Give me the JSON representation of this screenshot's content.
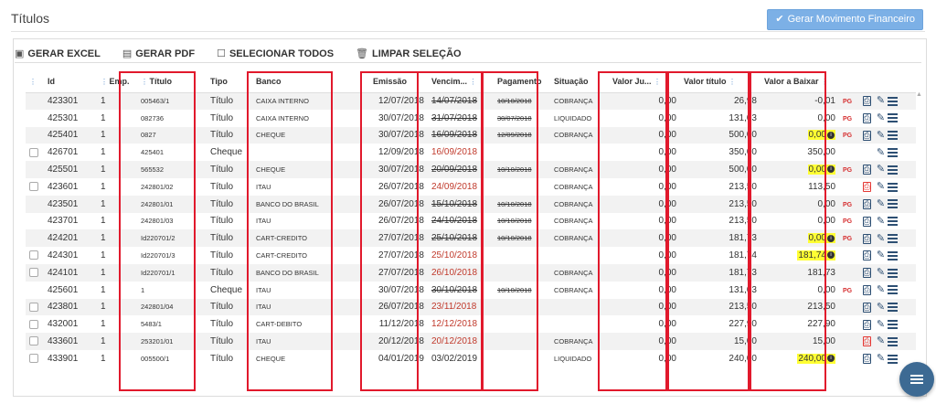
{
  "page": {
    "title": "Títulos",
    "primary_button": "Gerar Movimento Financeiro"
  },
  "toolbar": {
    "export_excel": "GERAR EXCEL",
    "export_pdf": "GERAR PDF",
    "select_all": "SELECIONAR TODOS",
    "clear_selection": "LIMPAR SELEÇÃO"
  },
  "table": {
    "headers": {
      "id": "Id",
      "emp": "Emp.",
      "titulo": "Título",
      "tipo": "Tipo",
      "banco": "Banco",
      "emissao": "Emissão",
      "vencimento": "Vencim...",
      "pagamento": "Pagamento",
      "situacao": "Situação",
      "valor_juros": "Valor Ju...",
      "valor_titulo": "Valor título",
      "valor_baixar": "Valor a Baixar"
    },
    "pg_label": "PG",
    "rows": [
      {
        "checkbox": false,
        "id": "423301",
        "emp": "1",
        "titulo": "005463/1",
        "tipo": "Título",
        "banco": "CAIXA INTERNO",
        "emissao": "12/07/2018",
        "vencimento": "14/07/2018",
        "venc_style": "strike",
        "pagamento": "10/10/2018",
        "situacao": "COBRANÇA",
        "valor_juros": "0,00",
        "valor_titulo": "26,98",
        "valor_baixar": "-0,01",
        "baixar_hl": false,
        "pg": true,
        "pdf_red": false
      },
      {
        "checkbox": false,
        "id": "425301",
        "emp": "1",
        "titulo": "082736",
        "tipo": "Título",
        "banco": "CAIXA INTERNO",
        "emissao": "30/07/2018",
        "vencimento": "31/07/2018",
        "venc_style": "strike",
        "pagamento": "30/07/2018",
        "situacao": "LIQUIDADO",
        "valor_juros": "0,00",
        "valor_titulo": "131,03",
        "valor_baixar": "0,00",
        "baixar_hl": false,
        "pg": true,
        "pdf_red": false
      },
      {
        "checkbox": false,
        "id": "425401",
        "emp": "1",
        "titulo": "0827",
        "tipo": "Título",
        "banco": "CHEQUE",
        "emissao": "30/07/2018",
        "vencimento": "16/09/2018",
        "venc_style": "strike",
        "pagamento": "12/09/2018",
        "situacao": "COBRANÇA",
        "valor_juros": "0,00",
        "valor_titulo": "500,00",
        "valor_baixar": "0,00",
        "baixar_hl": true,
        "pg": true,
        "pdf_red": false
      },
      {
        "checkbox": true,
        "id": "426701",
        "emp": "1",
        "titulo": "425401",
        "tipo": "Cheque",
        "banco": "",
        "emissao": "12/09/2018",
        "vencimento": "16/09/2018",
        "venc_style": "red",
        "pagamento": "",
        "situacao": "",
        "valor_juros": "0,00",
        "valor_titulo": "350,00",
        "valor_baixar": "350,00",
        "baixar_hl": false,
        "pg": false,
        "pdf_red": null
      },
      {
        "checkbox": false,
        "id": "425501",
        "emp": "1",
        "titulo": "565532",
        "tipo": "Título",
        "banco": "CHEQUE",
        "emissao": "30/07/2018",
        "vencimento": "20/09/2018",
        "venc_style": "strike",
        "pagamento": "10/10/2018",
        "situacao": "COBRANÇA",
        "valor_juros": "0,00",
        "valor_titulo": "500,00",
        "valor_baixar": "0,00",
        "baixar_hl": true,
        "pg": true,
        "pdf_red": false
      },
      {
        "checkbox": true,
        "id": "423601",
        "emp": "1",
        "titulo": "242801/02",
        "tipo": "Título",
        "banco": "ITAU",
        "emissao": "26/07/2018",
        "vencimento": "24/09/2018",
        "venc_style": "red",
        "pagamento": "",
        "situacao": "COBRANÇA",
        "valor_juros": "0,00",
        "valor_titulo": "213,50",
        "valor_baixar": "113,50",
        "baixar_hl": false,
        "pg": false,
        "pdf_red": true
      },
      {
        "checkbox": false,
        "id": "423501",
        "emp": "1",
        "titulo": "242801/01",
        "tipo": "Título",
        "banco": "BANCO DO BRASIL",
        "emissao": "26/07/2018",
        "vencimento": "15/10/2018",
        "venc_style": "strike",
        "pagamento": "10/10/2018",
        "situacao": "COBRANÇA",
        "valor_juros": "0,00",
        "valor_titulo": "213,50",
        "valor_baixar": "0,00",
        "baixar_hl": false,
        "pg": true,
        "pdf_red": false
      },
      {
        "checkbox": false,
        "id": "423701",
        "emp": "1",
        "titulo": "242801/03",
        "tipo": "Título",
        "banco": "ITAU",
        "emissao": "26/07/2018",
        "vencimento": "24/10/2018",
        "venc_style": "strike",
        "pagamento": "10/10/2018",
        "situacao": "COBRANÇA",
        "valor_juros": "0,00",
        "valor_titulo": "213,50",
        "valor_baixar": "0,00",
        "baixar_hl": false,
        "pg": true,
        "pdf_red": false
      },
      {
        "checkbox": false,
        "id": "424201",
        "emp": "1",
        "titulo": "Id220701/2",
        "tipo": "Título",
        "banco": "CART-CREDITO",
        "emissao": "27/07/2018",
        "vencimento": "25/10/2018",
        "venc_style": "strike",
        "pagamento": "10/10/2018",
        "situacao": "COBRANÇA",
        "valor_juros": "0,00",
        "valor_titulo": "181,73",
        "valor_baixar": "0,00",
        "baixar_hl": true,
        "pg": true,
        "pdf_red": false
      },
      {
        "checkbox": true,
        "id": "424301",
        "emp": "1",
        "titulo": "Id220701/3",
        "tipo": "Título",
        "banco": "CART-CREDITO",
        "emissao": "27/07/2018",
        "vencimento": "25/10/2018",
        "venc_style": "red",
        "pagamento": "",
        "situacao": "",
        "valor_juros": "0,00",
        "valor_titulo": "181,74",
        "valor_baixar": "181,74",
        "baixar_hl": true,
        "pg": false,
        "pdf_red": false
      },
      {
        "checkbox": true,
        "id": "424101",
        "emp": "1",
        "titulo": "Id220701/1",
        "tipo": "Título",
        "banco": "BANCO DO BRASIL",
        "emissao": "27/07/2018",
        "vencimento": "26/10/2018",
        "venc_style": "red",
        "pagamento": "",
        "situacao": "COBRANÇA",
        "valor_juros": "0,00",
        "valor_titulo": "181,73",
        "valor_baixar": "181,73",
        "baixar_hl": false,
        "pg": false,
        "pdf_red": false
      },
      {
        "checkbox": false,
        "id": "425601",
        "emp": "1",
        "titulo": "1",
        "tipo": "Cheque",
        "banco": "ITAU",
        "emissao": "30/07/2018",
        "vencimento": "30/10/2018",
        "venc_style": "strike",
        "pagamento": "10/10/2018",
        "situacao": "COBRANÇA",
        "valor_juros": "0,00",
        "valor_titulo": "131,03",
        "valor_baixar": "0,00",
        "baixar_hl": false,
        "pg": true,
        "pdf_red": false
      },
      {
        "checkbox": true,
        "id": "423801",
        "emp": "1",
        "titulo": "242801/04",
        "tipo": "Título",
        "banco": "ITAU",
        "emissao": "26/07/2018",
        "vencimento": "23/11/2018",
        "venc_style": "red",
        "pagamento": "",
        "situacao": "",
        "valor_juros": "0,00",
        "valor_titulo": "213,50",
        "valor_baixar": "213,50",
        "baixar_hl": false,
        "pg": false,
        "pdf_red": false
      },
      {
        "checkbox": true,
        "id": "432001",
        "emp": "1",
        "titulo": "5483/1",
        "tipo": "Título",
        "banco": "CART-DEBITO",
        "emissao": "11/12/2018",
        "vencimento": "12/12/2018",
        "venc_style": "red",
        "pagamento": "",
        "situacao": "",
        "valor_juros": "0,00",
        "valor_titulo": "227,90",
        "valor_baixar": "227,90",
        "baixar_hl": false,
        "pg": false,
        "pdf_red": false
      },
      {
        "checkbox": true,
        "id": "433601",
        "emp": "1",
        "titulo": "253201/01",
        "tipo": "Título",
        "banco": "ITAU",
        "emissao": "20/12/2018",
        "vencimento": "20/12/2018",
        "venc_style": "red",
        "pagamento": "",
        "situacao": "COBRANÇA",
        "valor_juros": "0,00",
        "valor_titulo": "15,00",
        "valor_baixar": "15,00",
        "baixar_hl": false,
        "pg": false,
        "pdf_red": true
      },
      {
        "checkbox": true,
        "id": "433901",
        "emp": "1",
        "titulo": "005500/1",
        "tipo": "Título",
        "banco": "CHEQUE",
        "emissao": "04/01/2019",
        "vencimento": "03/02/2019",
        "venc_style": "normal",
        "pagamento": "",
        "situacao": "LIQUIDADO",
        "valor_juros": "0,00",
        "valor_titulo": "240,00",
        "valor_baixar": "240,00",
        "baixar_hl": true,
        "pg": false,
        "pdf_red": false
      }
    ]
  },
  "colors": {
    "primary_button": "#7cb0e6",
    "highlight_box": "#e1192c",
    "overdue": "#c0392b",
    "value_highlight": "#ffff33",
    "fab": "#3d6a93"
  }
}
